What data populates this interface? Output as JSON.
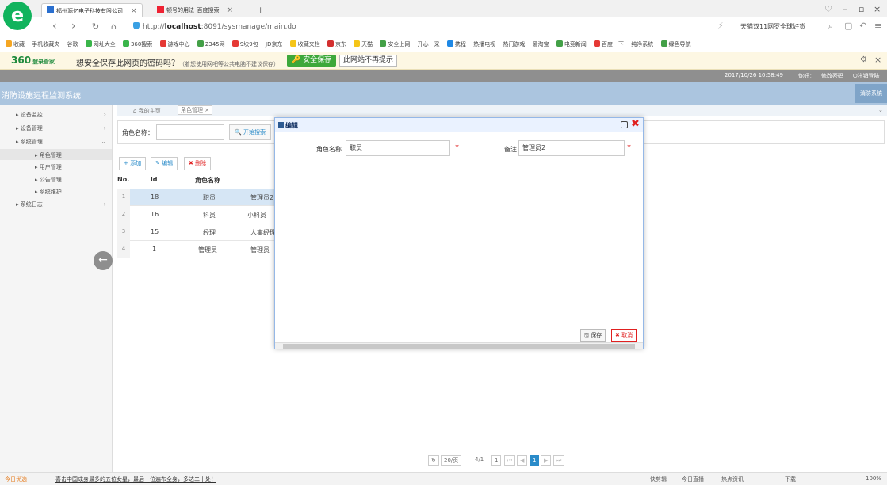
{
  "browser": {
    "tabs": [
      {
        "label": "福州源亿电子科技有限公司",
        "active": true
      },
      {
        "label": "顿号的用法_百度搜索",
        "active": false
      }
    ],
    "url_prefix": "http://",
    "url_host": "localhost",
    "url_rest": ":8091/sysmanage/main.do",
    "search_hint": "天猫双11网罗全球好货",
    "bookmarks": [
      "收藏",
      "手机收藏夹",
      "谷歌",
      "网址大全",
      "360搜索",
      "游戏中心",
      "2345网",
      "9块9包",
      "JD京东",
      "收藏夹栏",
      "京东",
      "天猫",
      "安全上网",
      "开心一采",
      "携程",
      "热播电视",
      "热门游戏",
      "爱淘宝",
      "电竞新闻",
      "百度一下",
      "纯净系统",
      "绿色导航"
    ],
    "password_bar": {
      "logo": "360",
      "logo_sub": "登录管家",
      "question": "想安全保存此网页的密码吗？",
      "note": "（着您使用网吧等公共电脑不建议保存）",
      "save_btn": "安全保存",
      "nomore_btn": "此网站不再提示"
    },
    "status_left": "今日优选",
    "status_news": "喜击中国成身最多的五位女星，最后一位遍布全身，多达二十处！",
    "status_right": [
      "快剪辑",
      "今日直播",
      "热点资讯",
      "下载",
      "100%"
    ]
  },
  "app": {
    "datetime": "2017/10/26 10:58:49",
    "greeting": "你好：",
    "change_pwd": "修改密码",
    "logout": "注销登陆",
    "system_title": "消防设施远程监测系统",
    "system_btn": "消防系统",
    "sidebar": [
      {
        "label": "设备监控",
        "level": 0
      },
      {
        "label": "设备管理",
        "level": 0
      },
      {
        "label": "系统管理",
        "level": 0
      },
      {
        "label": "角色管理",
        "level": 1
      },
      {
        "label": "用户管理",
        "level": 1
      },
      {
        "label": "公告管理",
        "level": 1
      },
      {
        "label": "系统维护",
        "level": 1
      },
      {
        "label": "系统日志",
        "level": 0
      }
    ],
    "crumbs": {
      "home": "我的主页",
      "current": "角色管理"
    },
    "search": {
      "label": "角色名称：",
      "value": "",
      "button": "开始搜索"
    },
    "toolbar": {
      "add": "添加",
      "edit": "编辑",
      "delete": "删除"
    },
    "grid": {
      "headers": {
        "no": "No.",
        "id": "id",
        "name": "角色名称"
      },
      "rows": [
        {
          "no": "1",
          "id": "18",
          "name": "职员",
          "remark": "管理员2"
        },
        {
          "no": "2",
          "id": "16",
          "name": "科员",
          "remark": "小科员"
        },
        {
          "no": "3",
          "id": "15",
          "name": "经理",
          "remark": "人事经理"
        },
        {
          "no": "4",
          "id": "1",
          "name": "管理员",
          "remark": "管理员"
        }
      ]
    },
    "pager": {
      "page_size": "20/页",
      "page_info": "4/1",
      "page_num": "1"
    }
  },
  "modal": {
    "title": "编辑",
    "role_label": "角色名称",
    "role_value": "职员",
    "remark_label": "备注",
    "remark_value": "管理员2",
    "save": "保存",
    "cancel": "取消"
  }
}
